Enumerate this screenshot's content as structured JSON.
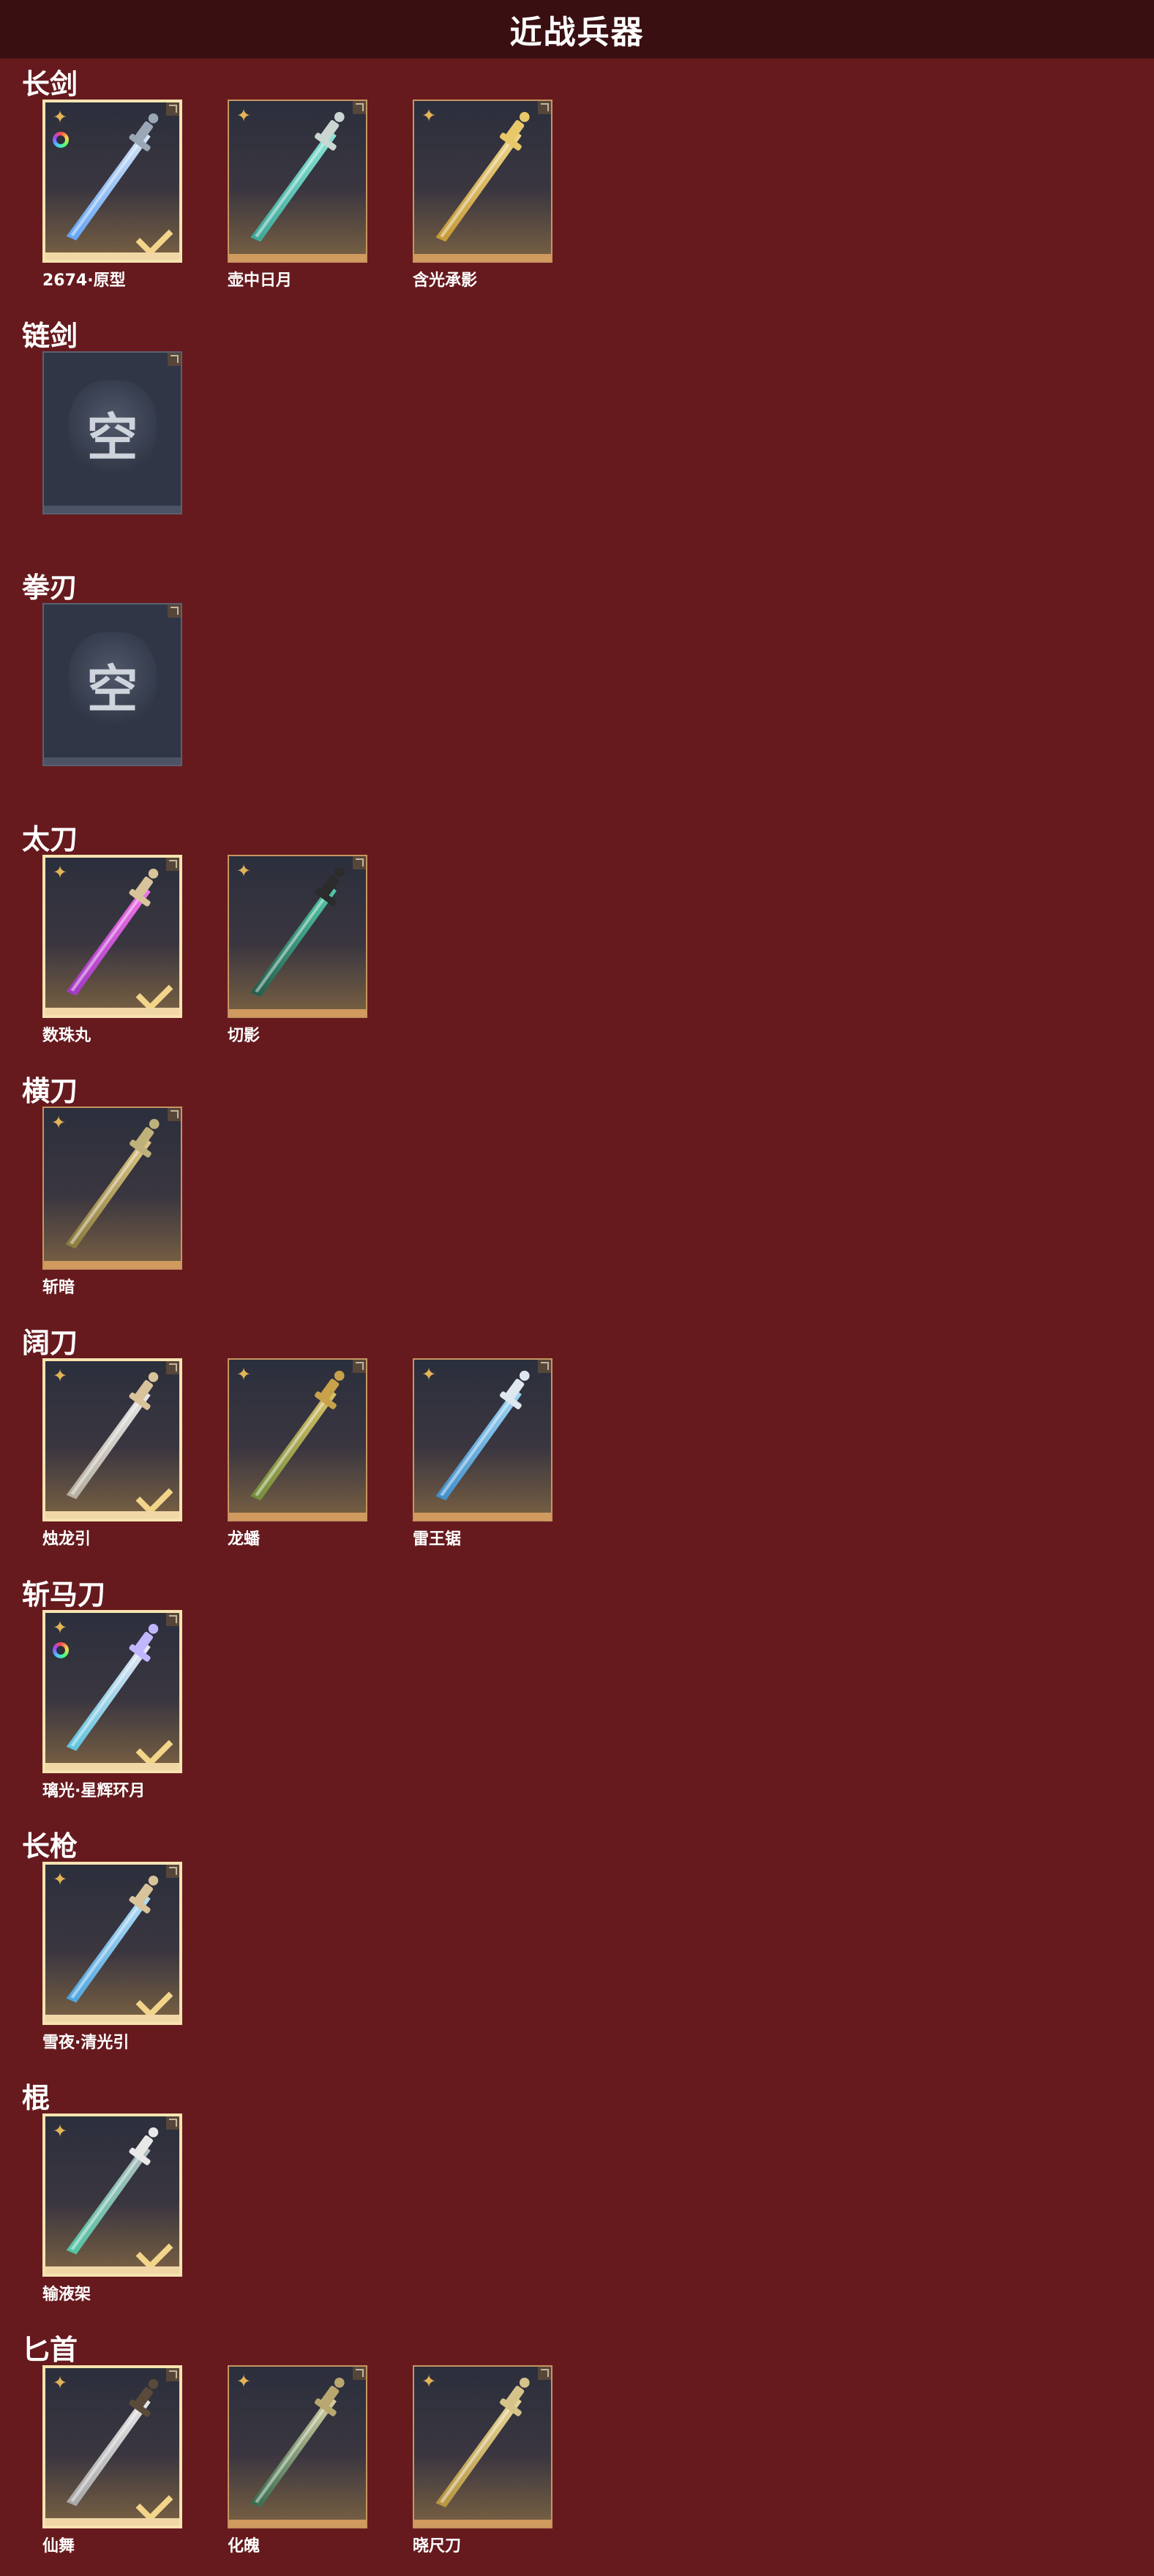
{
  "header": {
    "title": "近战兵器"
  },
  "sections": [
    {
      "title": "长剑",
      "items": [
        {
          "name": "2674·原型",
          "selected": true,
          "ring": true,
          "art": "blade-blue"
        },
        {
          "name": "壶中日月",
          "selected": false,
          "ring": false,
          "art": "blade-teal"
        },
        {
          "name": "含光承影",
          "selected": false,
          "ring": false,
          "art": "blade-gold"
        }
      ]
    },
    {
      "title": "链剑",
      "items": [
        {
          "empty": true,
          "empty_label": "空"
        }
      ]
    },
    {
      "title": "拳刃",
      "items": [
        {
          "empty": true,
          "empty_label": "空"
        }
      ]
    },
    {
      "title": "太刀",
      "items": [
        {
          "name": "数珠丸",
          "selected": true,
          "ring": false,
          "art": "katana-purple"
        },
        {
          "name": "切影",
          "selected": false,
          "ring": false,
          "art": "katana-dark"
        }
      ]
    },
    {
      "title": "横刀",
      "items": [
        {
          "name": "斩暗",
          "selected": false,
          "ring": false,
          "art": "dao-gold"
        }
      ]
    },
    {
      "title": "阔刀",
      "items": [
        {
          "name": "烛龙引",
          "selected": true,
          "ring": false,
          "art": "broad-white"
        },
        {
          "name": "龙蟠",
          "selected": false,
          "ring": false,
          "art": "broad-gold"
        },
        {
          "name": "雷王锯",
          "selected": false,
          "ring": false,
          "art": "broad-blue"
        }
      ]
    },
    {
      "title": "斩马刀",
      "items": [
        {
          "name": "璃光·星辉环月",
          "selected": true,
          "ring": true,
          "art": "glaive-moon"
        }
      ]
    },
    {
      "title": "长枪",
      "items": [
        {
          "name": "雪夜·清光引",
          "selected": true,
          "ring": false,
          "art": "spear-ice"
        }
      ]
    },
    {
      "title": "棍",
      "items": [
        {
          "name": "输液架",
          "selected": true,
          "ring": false,
          "art": "staff-iv"
        }
      ]
    },
    {
      "title": "匕首",
      "items": [
        {
          "name": "仙舞",
          "selected": true,
          "ring": false,
          "art": "dagger-white"
        },
        {
          "name": "化魄",
          "selected": false,
          "ring": false,
          "art": "dagger-green"
        },
        {
          "name": "晓尺刀",
          "selected": false,
          "ring": false,
          "art": "dagger-gold"
        }
      ]
    }
  ]
}
